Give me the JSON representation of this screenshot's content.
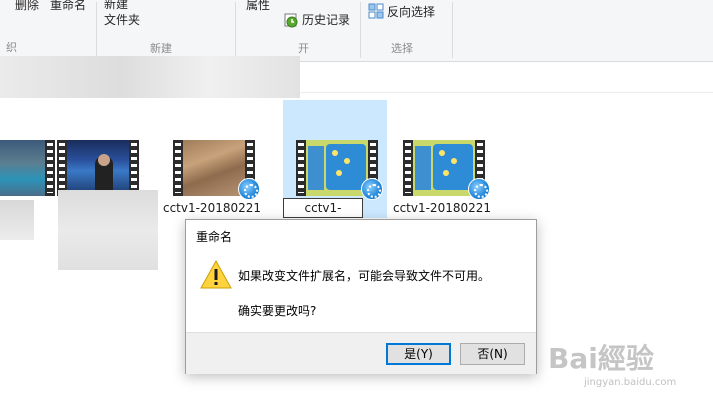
{
  "ribbon": {
    "delete_label": "删除",
    "rename_label": "重命名",
    "new_folder_label": "新建\n文件夹",
    "properties_label": "属性",
    "history_label": "历史记录",
    "invert_selection_label": "反向选择",
    "groups": {
      "organize": "织",
      "new": "新建",
      "open": "开",
      "select": "选择"
    }
  },
  "files": [
    {
      "name": ""
    },
    {
      "name": ""
    },
    {
      "name": "cctv1-20180221"
    },
    {
      "name": "cctv1-",
      "selected": true,
      "editing": true
    },
    {
      "name": "cctv1-20180221"
    }
  ],
  "dialog": {
    "title": "重命名",
    "message": "如果改变文件扩展名，可能会导致文件不可用。",
    "question": "确实要更改吗?",
    "yes_label": "是(Y)",
    "no_label": "否(N)"
  },
  "watermark": {
    "logo": "Bai經验",
    "url": "jingyan.baidu.com"
  },
  "colors": {
    "selection": "#cce8ff",
    "accent": "#0078d7",
    "warning": "#ffd23f"
  }
}
